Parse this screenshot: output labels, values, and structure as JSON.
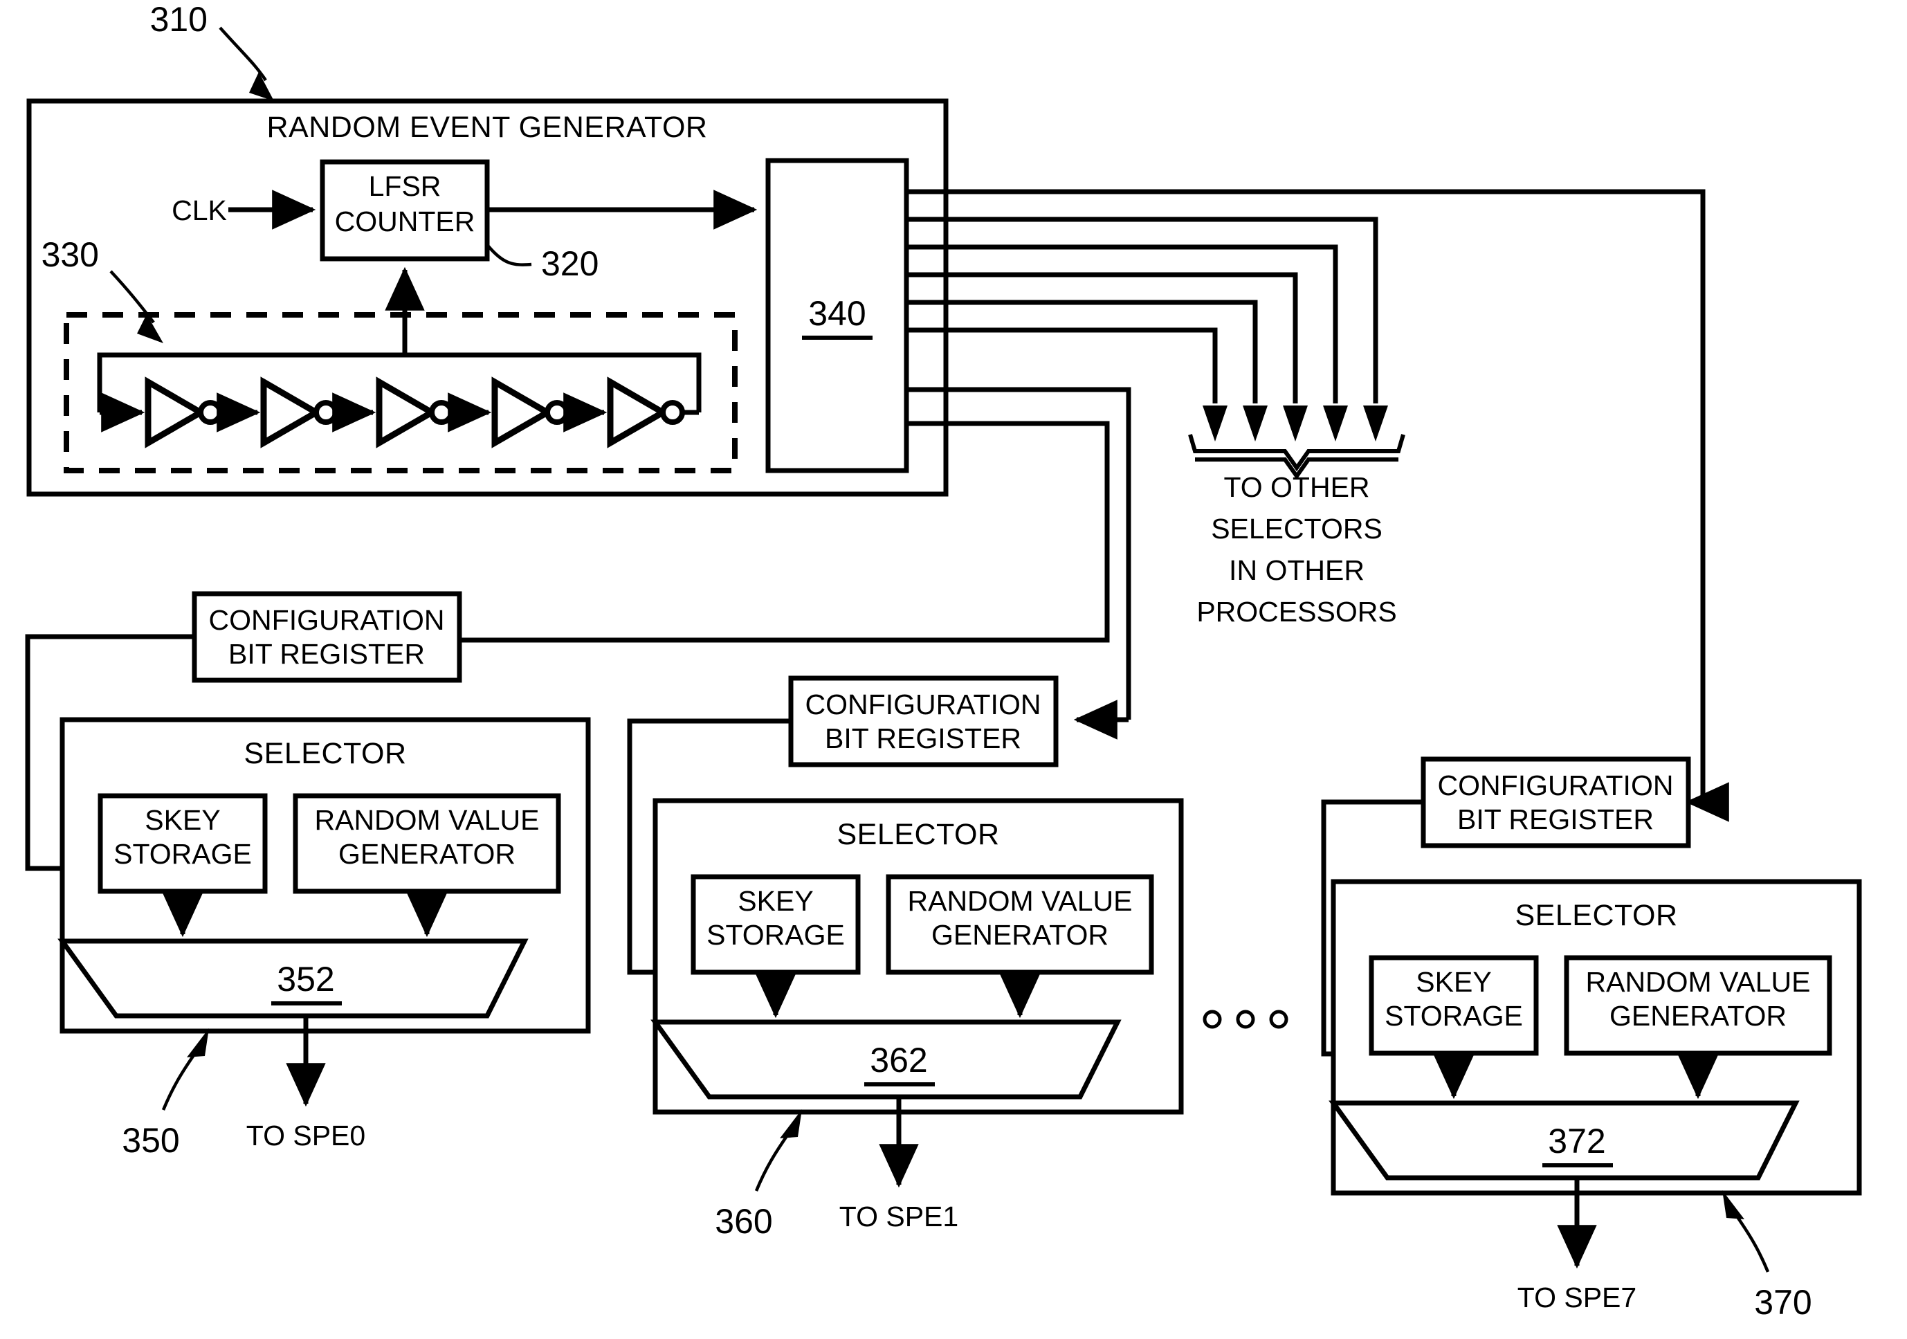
{
  "figure": {
    "title": "Random event generator with per-SPE selectors",
    "background": "#ffffff",
    "ink": "#000000"
  },
  "reference_numerals": {
    "random_event_generator": "310",
    "lfsr_counter": "320",
    "ring_oscillator": "330",
    "distributor": "340",
    "selector_0": "350",
    "mux_0": "352",
    "selector_1": "360",
    "mux_1": "362",
    "selector_n": "370",
    "mux_n": "372"
  },
  "random_event_generator": {
    "label": "RANDOM EVENT GENERATOR",
    "ref": "310",
    "clk_label": "CLK",
    "lfsr": {
      "line1": "LFSR",
      "line2": "COUNTER",
      "ref": "320"
    },
    "ring_oscillator": {
      "ref": "330",
      "inverter_count": 5
    },
    "distributor": {
      "ref": "340",
      "output_count": 8
    }
  },
  "fanout_note": {
    "line1": "TO OTHER",
    "line2": "SELECTORS",
    "line3": "IN OTHER",
    "line4": "PROCESSORS",
    "arrow_count": 5
  },
  "config_registers": [
    {
      "line1": "CONFIGURATION",
      "line2": "BIT REGISTER"
    },
    {
      "line1": "CONFIGURATION",
      "line2": "BIT REGISTER"
    },
    {
      "line1": "CONFIGURATION",
      "line2": "BIT REGISTER"
    }
  ],
  "selectors": [
    {
      "title": "SELECTOR",
      "ref": "350",
      "skey": {
        "line1": "SKEY",
        "line2": "STORAGE"
      },
      "rvg": {
        "line1": "RANDOM VALUE",
        "line2": "GENERATOR"
      },
      "mux_ref": "352",
      "output_label": "TO SPE0"
    },
    {
      "title": "SELECTOR",
      "ref": "360",
      "skey": {
        "line1": "SKEY",
        "line2": "STORAGE"
      },
      "rvg": {
        "line1": "RANDOM VALUE",
        "line2": "GENERATOR"
      },
      "mux_ref": "362",
      "output_label": "TO SPE1"
    },
    {
      "title": "SELECTOR",
      "ref": "370",
      "skey": {
        "line1": "SKEY",
        "line2": "STORAGE"
      },
      "rvg": {
        "line1": "RANDOM VALUE",
        "line2": "GENERATOR"
      },
      "mux_ref": "372",
      "output_label": "TO SPE7"
    }
  ],
  "ellipsis": {
    "dot_count": 3,
    "meaning": "continuation between selector 360 and selector 370"
  }
}
